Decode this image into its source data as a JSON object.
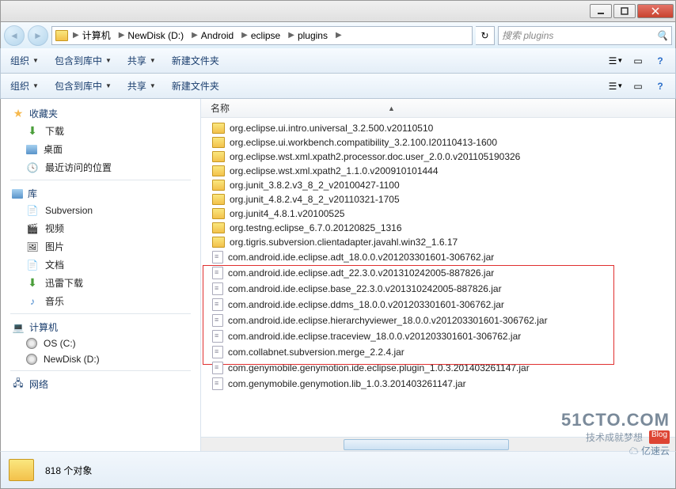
{
  "breadcrumbs": {
    "items": [
      {
        "label": "计算机"
      },
      {
        "label": "NewDisk (D:)"
      },
      {
        "label": "Android"
      },
      {
        "label": "eclipse"
      },
      {
        "label": "plugins"
      }
    ]
  },
  "search": {
    "placeholder": "搜索 plugins"
  },
  "toolbar": {
    "organize": "组织",
    "include": "包含到库中",
    "share": "共享",
    "newfolder": "新建文件夹"
  },
  "toolbar2": {
    "organize": "组织",
    "include": "包含到库中",
    "share": "共享",
    "newfolder": "新建文件夹"
  },
  "sidebar": {
    "favorites": {
      "header": "收藏夹",
      "items": [
        {
          "icon": "download",
          "label": "下载"
        },
        {
          "icon": "desktop",
          "label": "桌面"
        },
        {
          "icon": "recent",
          "label": "最近访问的位置"
        }
      ]
    },
    "libraries": {
      "header": "库",
      "items": [
        {
          "icon": "svn",
          "label": "Subversion"
        },
        {
          "icon": "video",
          "label": "视频"
        },
        {
          "icon": "pic",
          "label": "图片"
        },
        {
          "icon": "doc",
          "label": "文档"
        },
        {
          "icon": "xunlei",
          "label": "迅雷下载"
        },
        {
          "icon": "music",
          "label": "音乐"
        }
      ]
    },
    "computer": {
      "header": "计算机",
      "items": [
        {
          "icon": "drive",
          "label": "OS (C:)"
        },
        {
          "icon": "drive",
          "label": "NewDisk (D:)"
        }
      ]
    },
    "network": {
      "header": "网络"
    }
  },
  "columns": {
    "name": "名称"
  },
  "files": [
    {
      "type": "folder",
      "name": "org.eclipse.ui.intro.universal_3.2.500.v20110510"
    },
    {
      "type": "folder",
      "name": "org.eclipse.ui.workbench.compatibility_3.2.100.I20110413-1600"
    },
    {
      "type": "folder",
      "name": "org.eclipse.wst.xml.xpath2.processor.doc.user_2.0.0.v201105190326"
    },
    {
      "type": "folder",
      "name": "org.eclipse.wst.xml.xpath2_1.1.0.v200910101444"
    },
    {
      "type": "folder",
      "name": "org.junit_3.8.2.v3_8_2_v20100427-1100"
    },
    {
      "type": "folder",
      "name": "org.junit_4.8.2.v4_8_2_v20110321-1705"
    },
    {
      "type": "folder",
      "name": "org.junit4_4.8.1.v20100525"
    },
    {
      "type": "folder",
      "name": "org.testng.eclipse_6.7.0.20120825_1316"
    },
    {
      "type": "folder",
      "name": "org.tigris.subversion.clientadapter.javahl.win32_1.6.17"
    },
    {
      "type": "jar",
      "name": "com.android.ide.eclipse.adt_18.0.0.v201203301601-306762.jar",
      "hl": true
    },
    {
      "type": "jar",
      "name": "com.android.ide.eclipse.adt_22.3.0.v201310242005-887826.jar",
      "hl": true
    },
    {
      "type": "jar",
      "name": "com.android.ide.eclipse.base_22.3.0.v201310242005-887826.jar",
      "hl": true
    },
    {
      "type": "jar",
      "name": "com.android.ide.eclipse.ddms_18.0.0.v201203301601-306762.jar",
      "hl": true
    },
    {
      "type": "jar",
      "name": "com.android.ide.eclipse.hierarchyviewer_18.0.0.v201203301601-306762.jar",
      "hl": true
    },
    {
      "type": "jar",
      "name": "com.android.ide.eclipse.traceview_18.0.0.v201203301601-306762.jar",
      "hl": true
    },
    {
      "type": "jar",
      "name": "com.collabnet.subversion.merge_2.2.4.jar"
    },
    {
      "type": "jar",
      "name": "com.genymobile.genymotion.ide.eclipse.plugin_1.0.3.201403261147.jar"
    },
    {
      "type": "jar",
      "name": "com.genymobile.genymotion.lib_1.0.3.201403261147.jar"
    }
  ],
  "status": {
    "count": "818 个对象"
  },
  "watermark": {
    "line1": "51CTO.COM",
    "line2a": "技术成就梦想",
    "blog": "Blog",
    "brand": "亿速云"
  }
}
